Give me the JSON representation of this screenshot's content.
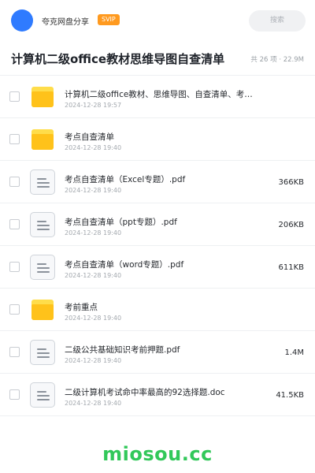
{
  "header": {
    "user_name": "夸克网盘分享",
    "badge": "SVIP",
    "search_placeholder": "搜索",
    "avatar_color": "#2f7bff",
    "badge_color": "#ff9a1f"
  },
  "folder": {
    "title": "计算机二级office教材思维导图自查清单",
    "count_info": "共 26 项 · 22.9M"
  },
  "files": [
    {
      "type": "folder",
      "name": "计算机二级office教材、思维导图、自查清单、考…",
      "date": "2024-12-28 19:57",
      "size": ""
    },
    {
      "type": "folder",
      "name": "考点自查清单",
      "date": "2024-12-28 19:40",
      "size": ""
    },
    {
      "type": "doc",
      "name": "考点自查清单（Excel专题）.pdf",
      "date": "2024-12-28 19:40",
      "size": "366KB"
    },
    {
      "type": "doc",
      "name": "考点自查清单（ppt专题）.pdf",
      "date": "2024-12-28 19:40",
      "size": "206KB"
    },
    {
      "type": "doc",
      "name": "考点自查清单（word专题）.pdf",
      "date": "2024-12-28 19:40",
      "size": "611KB"
    },
    {
      "type": "folder",
      "name": "考前重点",
      "date": "2024-12-28 19:40",
      "size": ""
    },
    {
      "type": "doc",
      "name": "二级公共基础知识考前押题.pdf",
      "date": "2024-12-28 19:40",
      "size": "1.4M"
    },
    {
      "type": "doc",
      "name": "二级计算机考试命中率最高的92选择题.doc",
      "date": "2024-12-28 19:40",
      "size": "41.5KB"
    }
  ],
  "watermark": "miosou.cc"
}
